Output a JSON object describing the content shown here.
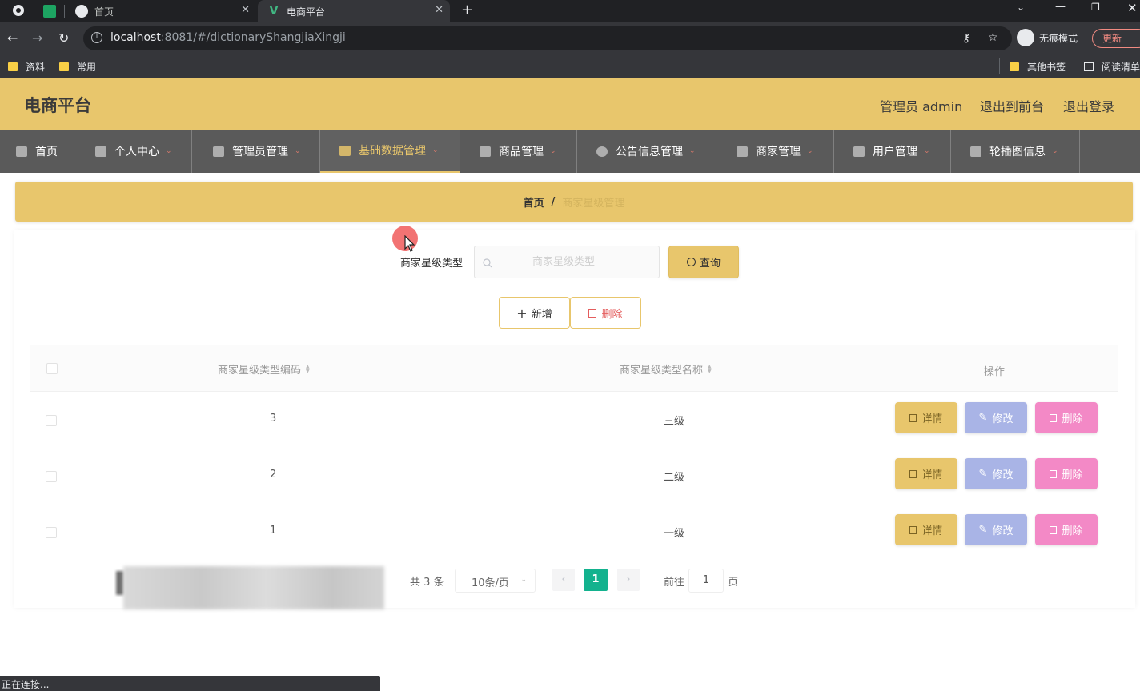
{
  "browser": {
    "tabs": [
      {
        "title": "首页",
        "active": false
      },
      {
        "title": "电商平台",
        "active": true
      }
    ],
    "new_tab": "+",
    "url_host": "localhost",
    "url_rest": ":8081/#/dictionaryShangjiaXingji",
    "incognito_label": "无痕模式",
    "update_label": "更新",
    "bookmarks": [
      "资料",
      "常用"
    ],
    "other_bookmarks": "其他书签",
    "reading_list": "阅读清单",
    "status_text": "正在连接..."
  },
  "app": {
    "title": "电商平台",
    "user_label": "管理员 admin",
    "to_front_label": "退出到前台",
    "logout_label": "退出登录",
    "accent_color": "#e8c66c"
  },
  "nav": {
    "items": [
      {
        "label": "首页",
        "icon": "home-icon"
      },
      {
        "label": "个人中心",
        "icon": "user-icon"
      },
      {
        "label": "管理员管理",
        "icon": "flag-icon"
      },
      {
        "label": "基础数据管理",
        "icon": "picture-icon",
        "active": true
      },
      {
        "label": "商品管理",
        "icon": "goods-icon"
      },
      {
        "label": "公告信息管理",
        "icon": "notice-icon"
      },
      {
        "label": "商家管理",
        "icon": "shop-icon"
      },
      {
        "label": "用户管理",
        "icon": "users-icon"
      },
      {
        "label": "轮播图信息",
        "icon": "carousel-icon"
      }
    ]
  },
  "breadcrumb": {
    "home": "首页",
    "separator": "/",
    "current": "商家星级管理"
  },
  "search": {
    "label": "商家星级类型",
    "placeholder": "商家星级类型",
    "button_label": "查询"
  },
  "actions": {
    "add_label": "新增",
    "delete_label": "删除"
  },
  "table": {
    "columns": [
      "商家星级类型编码",
      "商家星级类型名称",
      "操作"
    ],
    "rows": [
      {
        "code": "3",
        "name": "三级"
      },
      {
        "code": "2",
        "name": "二级"
      },
      {
        "code": "1",
        "name": "一级"
      }
    ],
    "row_actions": {
      "detail": "详情",
      "edit": "修改",
      "delete": "删除"
    }
  },
  "pagination": {
    "total_label": "共 3 条",
    "page_size": "10条/页",
    "current_page": "1",
    "goto_label": "前往",
    "goto_value": "1",
    "page_unit": "页"
  }
}
